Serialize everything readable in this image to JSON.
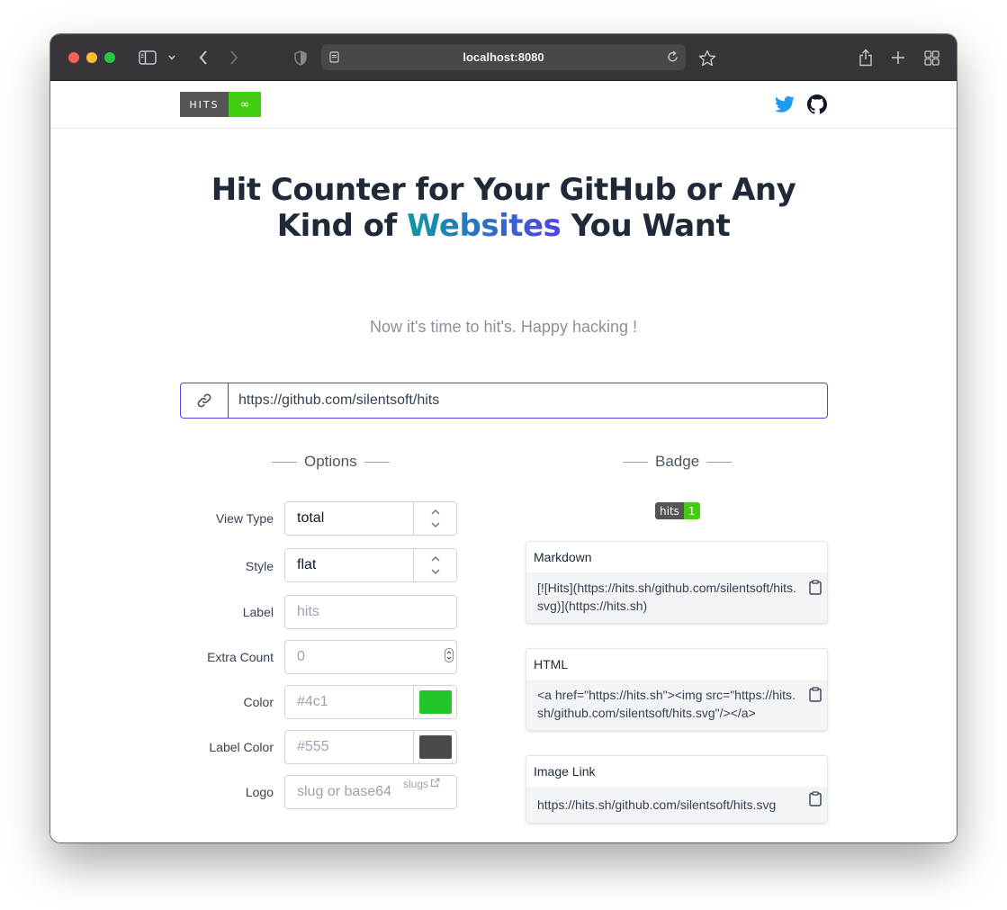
{
  "browser": {
    "address": "localhost:8080"
  },
  "nav": {
    "logo_left": "HITS",
    "logo_right": "∞"
  },
  "hero": {
    "line1": "Hit Counter for Your GitHub or Any",
    "line2_pre": "Kind of ",
    "line2_highlight": "Websites",
    "line2_post": " You Want",
    "subtitle": "Now it's time to hit's. Happy hacking !"
  },
  "url_input": {
    "value": "https://github.com/silentsoft/hits"
  },
  "options": {
    "heading": "Options",
    "view_type": {
      "label": "View Type",
      "value": "total"
    },
    "style": {
      "label": "Style",
      "value": "flat"
    },
    "label_field": {
      "label": "Label",
      "placeholder": "hits"
    },
    "extra_count": {
      "label": "Extra Count",
      "placeholder": "0"
    },
    "color": {
      "label": "Color",
      "placeholder": "#4c1",
      "swatch": "#22c52a"
    },
    "label_color": {
      "label": "Label Color",
      "placeholder": "#555",
      "swatch": "#4a4a4a"
    },
    "logo": {
      "label": "Logo",
      "placeholder": "slug or base64"
    },
    "slugs_link": "slugs"
  },
  "badge": {
    "heading": "Badge",
    "preview_label": "hits",
    "preview_count": "1",
    "markdown": {
      "title": "Markdown",
      "code": "[![Hits](https://hits.sh/github.com/silentsoft/hits.svg)](https://hits.sh)"
    },
    "html": {
      "title": "HTML",
      "code": "<a href=\"https://hits.sh\"><img src=\"https://hits.sh/github.com/silentsoft/hits.svg\"/></a>"
    },
    "image_link": {
      "title": "Image Link",
      "code": "https://hits.sh/github.com/silentsoft/hits.svg"
    }
  },
  "colors": {
    "accent": "#4f46e5",
    "gradient_start": "#0d9aa0",
    "twitter": "#1d9bf0"
  }
}
